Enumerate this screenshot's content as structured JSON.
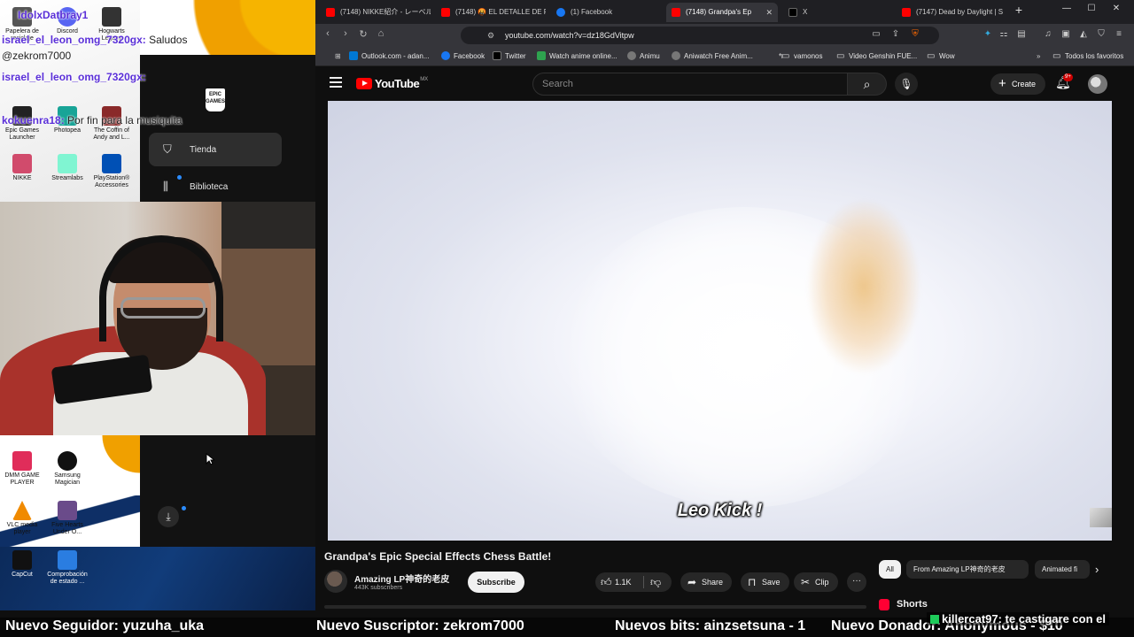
{
  "overlay": {
    "chat_lines": [
      {
        "user": "IdolxDatbray1",
        "message": ""
      },
      {
        "user": "israel_el_leon_omg_7320gx:",
        "message": "Saludos"
      },
      {
        "user": "@zekrom7000",
        "message": ""
      },
      {
        "user": "israel_el_leon_omg_7320gx:",
        "message": ""
      },
      {
        "user": "kokuenra18:",
        "message": "Por fin para la musiquita"
      }
    ],
    "desktop_icons_top": [
      {
        "label": "Papelera de reciclaje",
        "color": "#555555"
      },
      {
        "label": "Discord",
        "color": "#5865f2"
      },
      {
        "label": "Hogwarts Legacy",
        "color": "#333333"
      },
      {
        "label": "Epic Games Launcher",
        "color": "#222222"
      },
      {
        "label": "Photopea",
        "color": "#18a497"
      },
      {
        "label": "The Coffin of Andy and L...",
        "color": "#8a2a2a"
      },
      {
        "label": "NIKKE",
        "color": "#d14b6c"
      },
      {
        "label": "Streamlabs",
        "color": "#80f5d2"
      },
      {
        "label": "PlayStation® Accessories",
        "color": "#0050b5"
      }
    ],
    "desktop_icons_bottom": [
      {
        "label": "DMM GAME PLAYER",
        "color": "#e02d5a"
      },
      {
        "label": "Samsung Magician",
        "color": "#111111"
      },
      {
        "label": "VLC media player",
        "color": "#f08a00"
      },
      {
        "label": "Five Hearts Under O...",
        "color": "#6a4b8a"
      },
      {
        "label": "CapCut",
        "color": "#111111"
      },
      {
        "label": "Comprobación de estado ...",
        "color": "#2a7de1"
      }
    ],
    "epic_logo": "EPIC GAMES",
    "epic_menu": [
      {
        "label": "Tienda",
        "icon": "store-icon",
        "active": true
      },
      {
        "label": "Biblioteca",
        "icon": "library-icon",
        "active": false
      }
    ]
  },
  "browser": {
    "tabs": [
      {
        "title": "(7148) NIKKE紹介 - レーベル",
        "active": false,
        "fav_color": "#ff0000"
      },
      {
        "title": "(7148) 🤬 EL DETALLE DE R",
        "active": false,
        "fav_color": "#ff0000"
      },
      {
        "title": "(1) Facebook",
        "active": false,
        "fav_color": "#1877f2"
      },
      {
        "title": "(7148) Grandpa's Ep",
        "active": true,
        "fav_color": "#ff0000"
      },
      {
        "title": "X",
        "active": false,
        "fav_color": "#000000"
      },
      {
        "title": "(7147) Dead by Daylight | S",
        "active": false,
        "fav_color": "#ff0000"
      }
    ],
    "new_tab_label": "+",
    "url": "youtube.com/watch?v=dz18GdVitpw",
    "bookmarks": [
      {
        "label": "Outlook.com - adan...",
        "color": "#0078d4"
      },
      {
        "label": "Facebook",
        "color": "#1877f2"
      },
      {
        "label": "Twitter",
        "color": "#000000"
      },
      {
        "label": "Watch anime online...",
        "color": "#2ea34f"
      },
      {
        "label": "Animu",
        "color": "#777777"
      },
      {
        "label": "Aniwatch Free Anim...",
        "color": "#777777"
      },
      {
        "label": "vamonos",
        "folder": true
      },
      {
        "label": "Video Genshin FUE...",
        "folder": true
      },
      {
        "label": "Wow",
        "folder": true
      }
    ],
    "all_bookmarks": "Todos los favoritos"
  },
  "youtube": {
    "logo_text": "YouTube",
    "region": "MX",
    "search_placeholder": "Search",
    "create_label": "Create",
    "notif_badge": "9+",
    "subtitle": "Leo Kick !",
    "video_title": "Grandpa's Epic Special Effects Chess Battle!",
    "channel_name": "Amazing LP神奇的老皮",
    "subscribers": "443K subscribers",
    "subscribe_label": "Subscribe",
    "likes": "1.1K",
    "share_label": "Share",
    "save_label": "Save",
    "clip_label": "Clip",
    "more_label": "···",
    "chips": [
      {
        "label": "All",
        "active": true
      },
      {
        "label": "From Amazing LP神奇的老皮",
        "active": false
      },
      {
        "label": "Animated fi",
        "active": false
      }
    ],
    "shorts_label": "Shorts"
  },
  "ticker": {
    "items": [
      "Nuevo Seguidor: yuzuha_uka",
      "Nuevo Suscriptor: zekrom7000",
      "Nuevos bits: ainzsetsuna - 1",
      "Nuevo Donador: Anonymous - $10"
    ],
    "chat_user": "killercat97",
    "chat_msg": ": te castigare con el"
  }
}
